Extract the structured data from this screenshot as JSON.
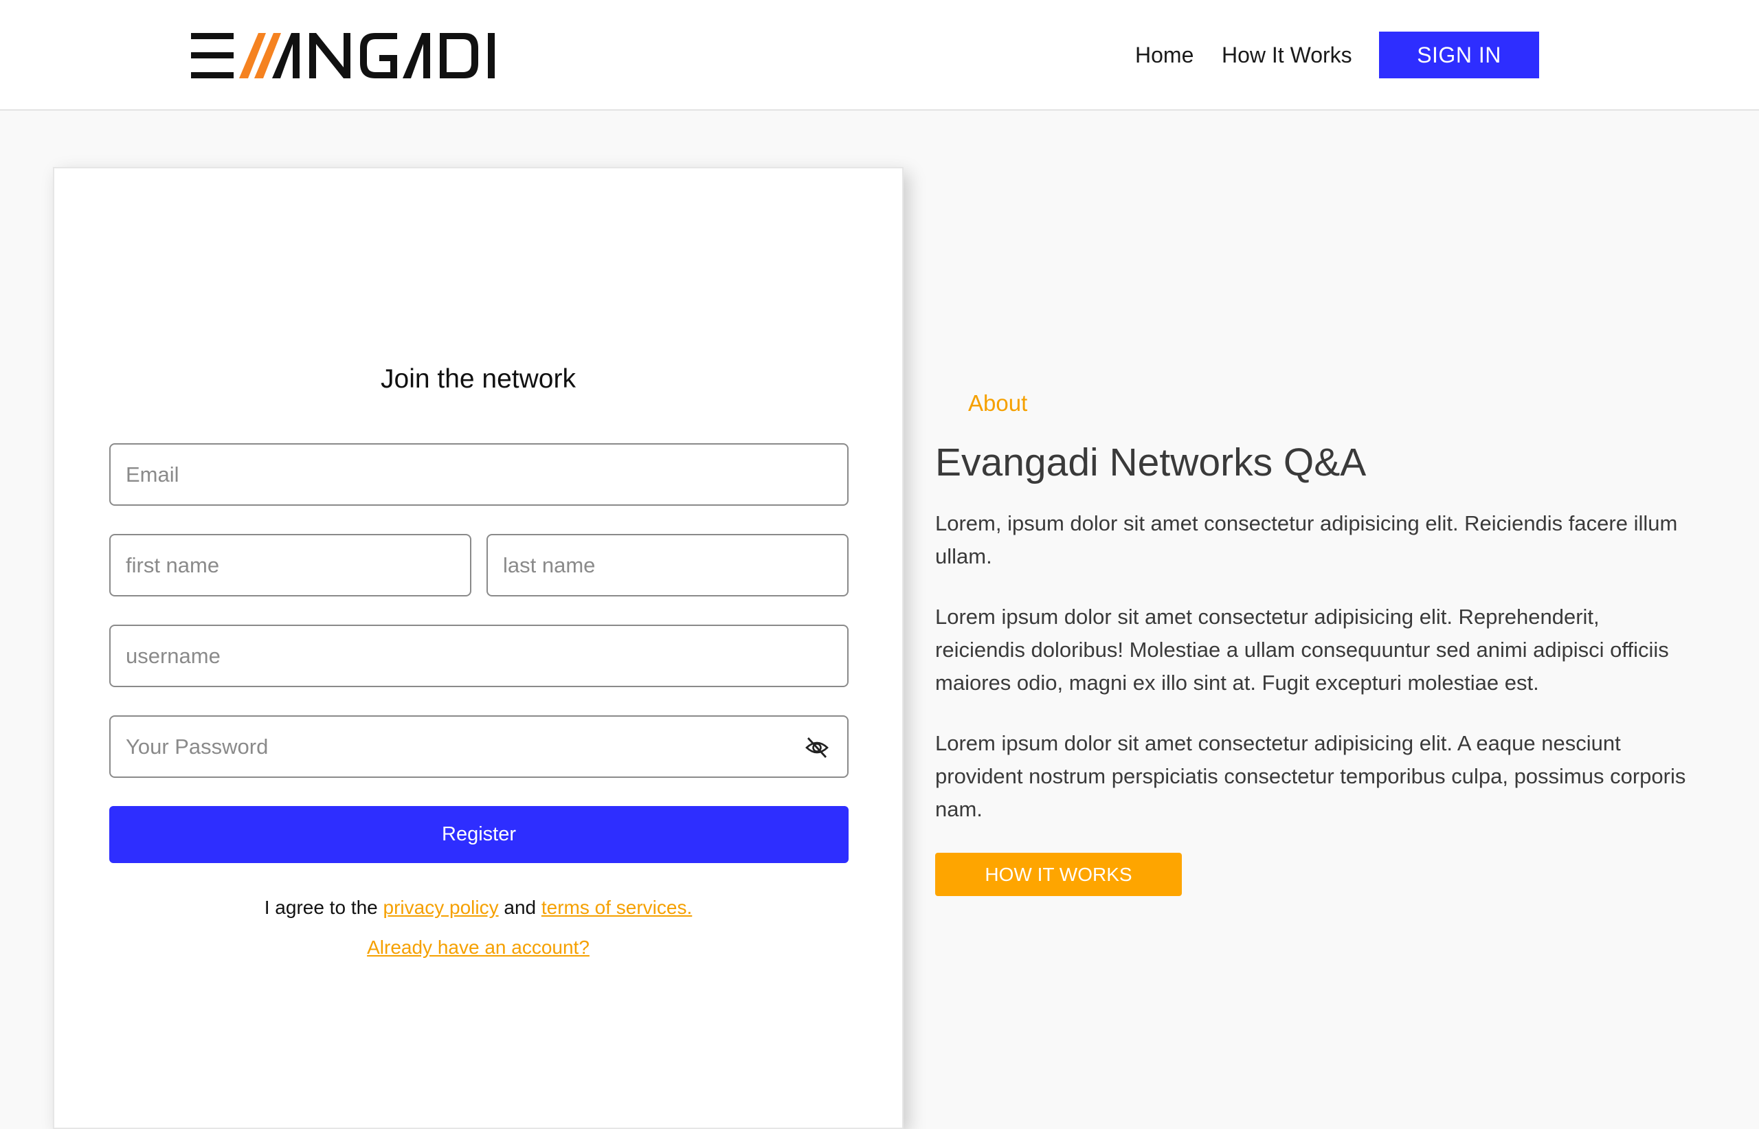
{
  "brand": {
    "logo_text": "EVANGADI",
    "accent_color": "#fea500",
    "primary_color": "#2e2eff"
  },
  "nav": {
    "home": "Home",
    "how_it_works": "How It Works",
    "sign_in": "SIGN IN"
  },
  "form": {
    "title": "Join the network",
    "email_placeholder": "Email",
    "first_name_placeholder": "first name",
    "last_name_placeholder": "last name",
    "username_placeholder": "username",
    "password_placeholder": "Your Password",
    "password_toggle_icon": "eye-slash-icon",
    "register_label": "Register",
    "agree_prefix": "I agree to the",
    "privacy_policy": "privacy policy",
    "agree_and": "and",
    "terms": "terms of services.",
    "already_account": "Already have an account?"
  },
  "about": {
    "label": "About",
    "title": "Evangadi Networks Q&A",
    "paragraphs": [
      "Lorem, ipsum dolor sit amet consectetur adipisicing elit. Reiciendis facere illum ullam.",
      "Lorem ipsum dolor sit amet consectetur adipisicing elit. Reprehenderit, reiciendis doloribus! Molestiae a ullam consequuntur sed animi adipisci officiis maiores odio, magni ex illo sint at. Fugit excepturi molestiae est.",
      "Lorem ipsum dolor sit amet consectetur adipisicing elit. A eaque nesciunt provident nostrum perspiciatis consectetur temporibus culpa, possimus corporis nam."
    ],
    "button": "HOW IT WORKS"
  }
}
